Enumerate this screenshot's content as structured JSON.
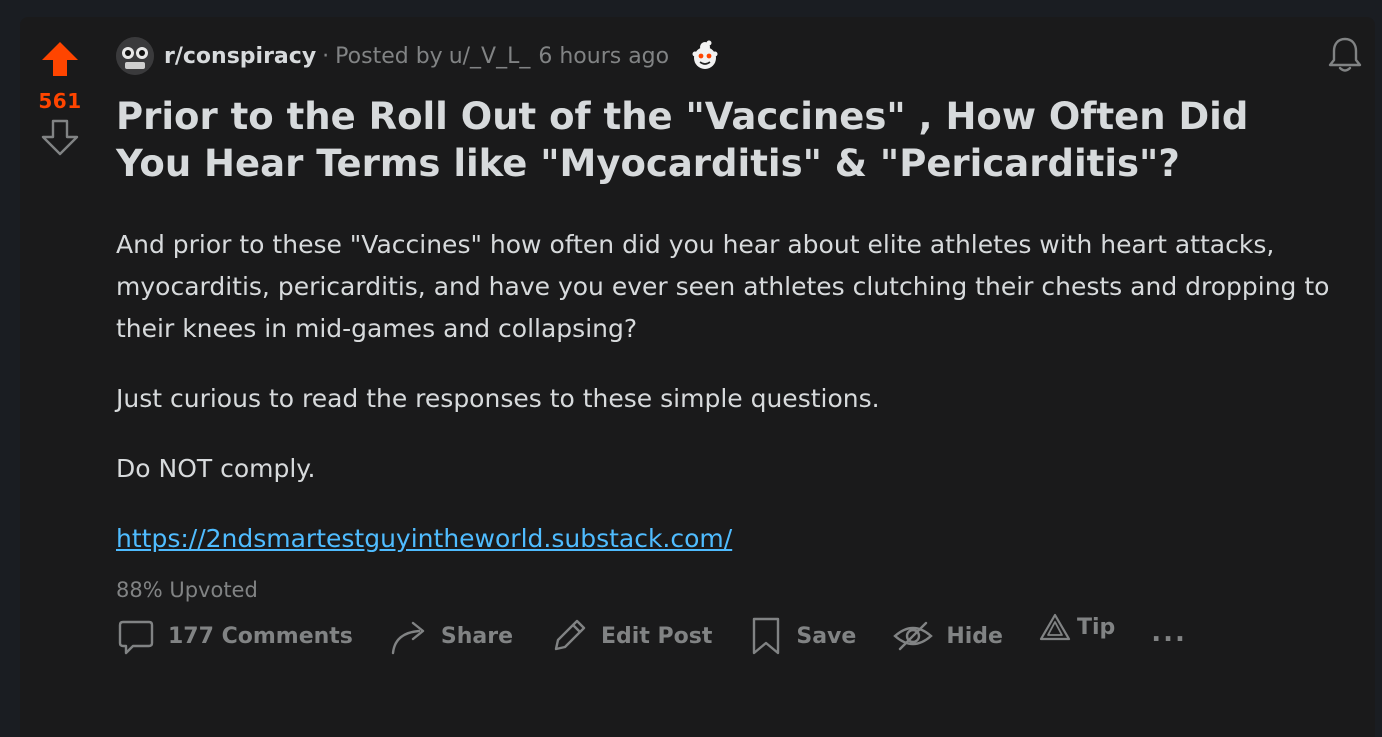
{
  "post": {
    "score": "561",
    "subreddit": "r/conspiracy",
    "separator": "·",
    "posted_by": "Posted by",
    "author": "u/_V_L_",
    "time": "6 hours ago",
    "title": "Prior to the Roll Out of the \"Vaccines\" , How Often Did You Hear Terms like \"Myocarditis\" & \"Pericarditis\"?",
    "paragraphs": [
      "And prior to these \"Vaccines\" how often did you hear about elite athletes with heart attacks, myocarditis, pericarditis, and have you ever seen athletes clutching their chests and dropping to their knees in mid-games and collapsing?",
      "Just curious to read the responses to these simple questions.",
      "Do NOT comply."
    ],
    "link": "https://2ndsmartestguyintheworld.substack.com/",
    "upvoted": "88% Upvoted"
  },
  "actions": {
    "comments": "177 Comments",
    "share": "Share",
    "edit": "Edit Post",
    "save": "Save",
    "hide": "Hide",
    "tip": "Tip",
    "more": "..."
  },
  "icons": {
    "upvote": "upvote-arrow-icon",
    "downvote": "downvote-arrow-icon",
    "bell": "bell-icon",
    "comment": "comment-bubble-icon",
    "share": "share-arrow-icon",
    "edit": "pencil-icon",
    "save": "bookmark-icon",
    "hide": "eye-slash-icon",
    "tip": "tip-triangle-icon"
  },
  "colors": {
    "upvote_active": "#ff4500",
    "link": "#4fbcff",
    "muted": "#818384",
    "text": "#d7dadc",
    "card_bg": "#1a1a1b"
  }
}
